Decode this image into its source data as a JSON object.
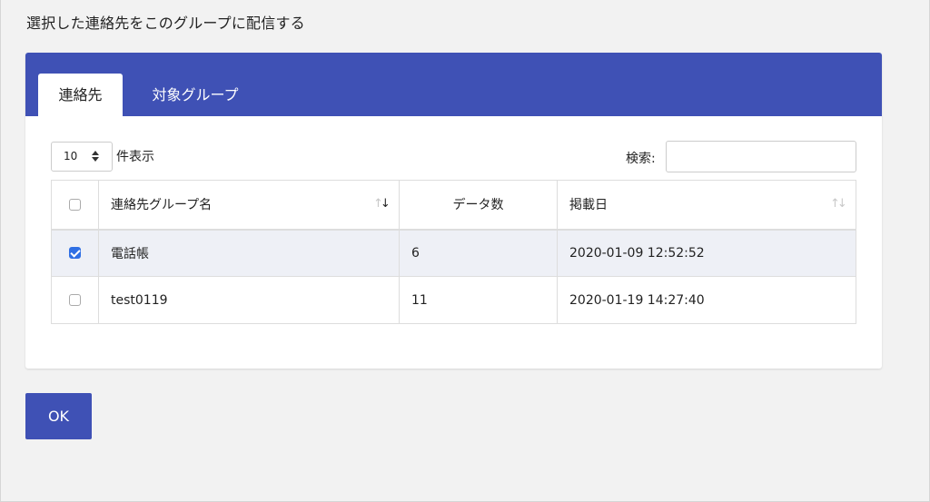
{
  "page": {
    "heading": "選択した連絡先をこのグループに配信する"
  },
  "tabs": [
    {
      "label": "連絡先",
      "active": true
    },
    {
      "label": "対象グループ",
      "active": false
    }
  ],
  "controls": {
    "page_length": "10",
    "page_length_suffix": "件表示",
    "search_label": "検索:",
    "search_value": ""
  },
  "table": {
    "headers": [
      "連絡先グループ名",
      "データ数",
      "掲載日"
    ],
    "rows": [
      {
        "checked": true,
        "name": "電話帳",
        "count": "6",
        "date": "2020-01-09 12:52:52"
      },
      {
        "checked": false,
        "name": "test0119",
        "count": "11",
        "date": "2020-01-19 14:27:40"
      }
    ]
  },
  "footer": {
    "ok_label": "OK"
  },
  "colors": {
    "accent": "#3f51b5",
    "checkbox": "#2f6fe4",
    "selected_row": "#eef0f6"
  },
  "icons": {
    "sort": "sort-arrows-icon",
    "select_arrows": "select-updown-icon"
  }
}
